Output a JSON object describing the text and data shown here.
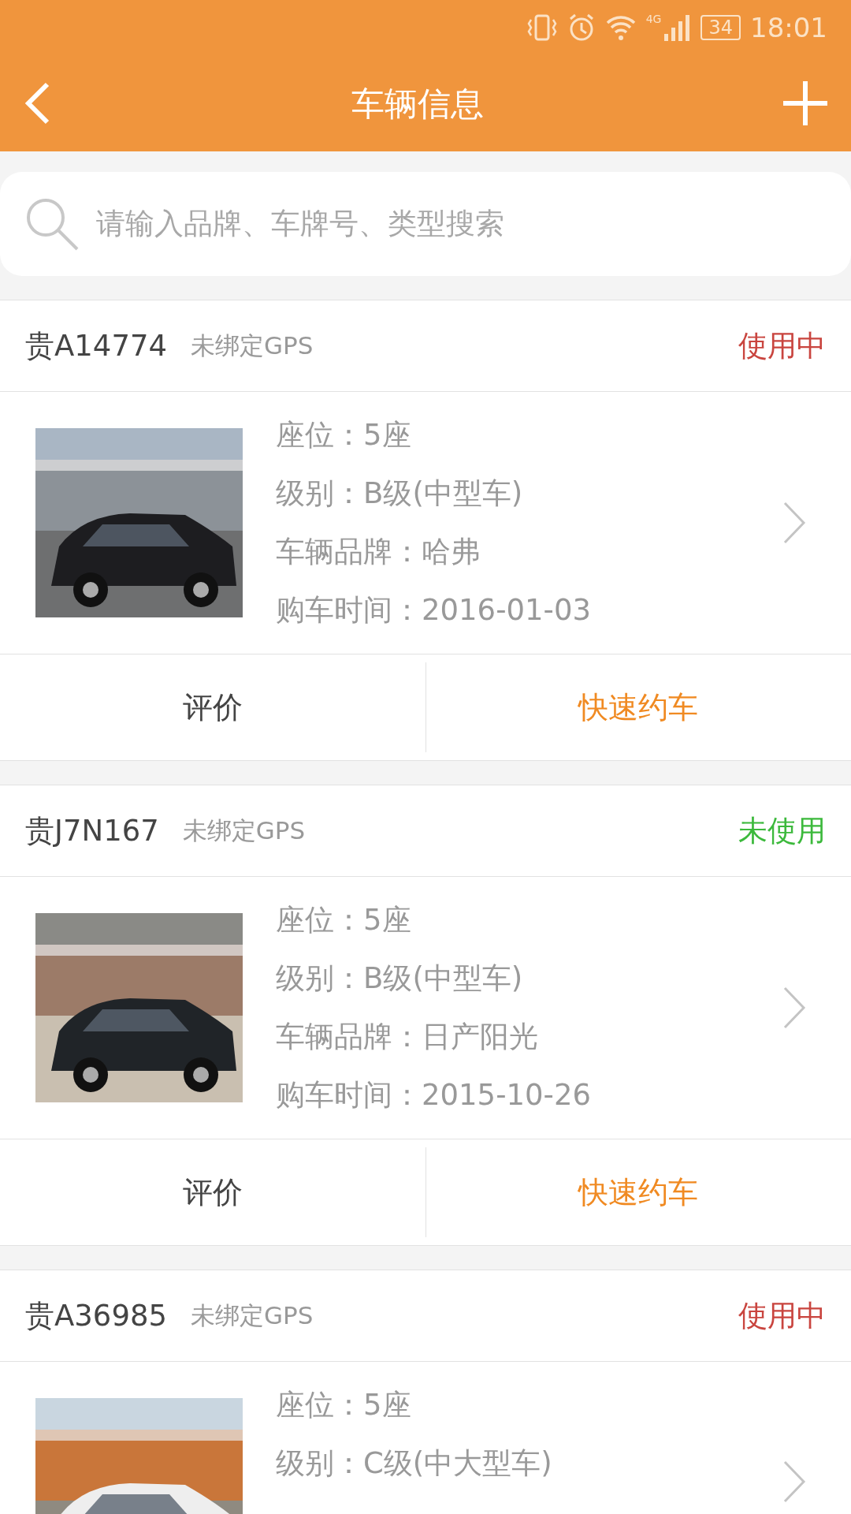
{
  "status_bar": {
    "network": "4G",
    "battery": "34",
    "time": "18:01"
  },
  "nav": {
    "title": "车辆信息"
  },
  "search": {
    "placeholder": "请输入品牌、车牌号、类型搜索"
  },
  "vehicles": [
    {
      "plate": "贵A14774",
      "gps": "未绑定GPS",
      "status": {
        "text": "使用中",
        "kind": "in_use"
      },
      "photo": {
        "kind": "picture"
      },
      "details": [
        {
          "label": "座位：",
          "value": "5座"
        },
        {
          "label": "级别：",
          "value": "B级(中型车)"
        },
        {
          "label": "车辆品牌：",
          "value": "哈弗"
        },
        {
          "label": "购车时间：",
          "value": "2016-01-03"
        }
      ],
      "actions": [
        "评价",
        "快速约车"
      ]
    },
    {
      "plate": "贵J7N167",
      "gps": "未绑定GPS",
      "status": {
        "text": "未使用",
        "kind": "unused"
      },
      "photo": {
        "kind": "picture"
      },
      "details": [
        {
          "label": "座位：",
          "value": "5座"
        },
        {
          "label": "级别：",
          "value": "B级(中型车)"
        },
        {
          "label": "车辆品牌：",
          "value": "日产阳光"
        },
        {
          "label": "购车时间：",
          "value": "2015-10-26"
        }
      ],
      "actions": [
        "评价",
        "快速约车"
      ]
    },
    {
      "plate": "贵A36985",
      "gps": "未绑定GPS",
      "status": {
        "text": "使用中",
        "kind": "in_use"
      },
      "photo": {
        "kind": "picture"
      },
      "details": [
        {
          "label": "座位：",
          "value": "5座"
        },
        {
          "label": "级别：",
          "value": "C级(中大型车)"
        }
      ]
    }
  ]
}
